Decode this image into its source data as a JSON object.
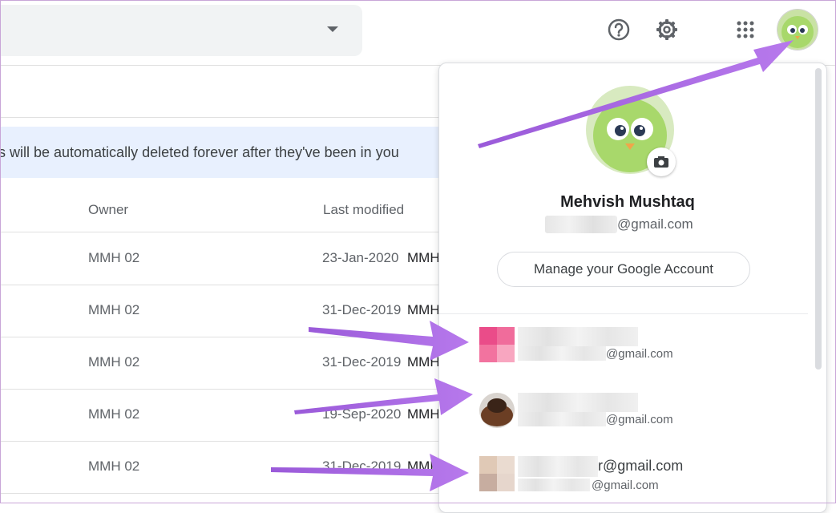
{
  "banner": {
    "text": "s will be automatically deleted forever after they've been in you"
  },
  "table": {
    "headers": {
      "owner": "Owner",
      "last_modified": "Last modified"
    },
    "rows": [
      {
        "owner": "MMH 02",
        "date": "23-Jan-2020",
        "user": "MMH"
      },
      {
        "owner": "MMH 02",
        "date": "31-Dec-2019",
        "user": "MMH"
      },
      {
        "owner": "MMH 02",
        "date": "31-Dec-2019",
        "user": "MMH"
      },
      {
        "owner": "MMH 02",
        "date": "19-Sep-2020",
        "user": "MMH"
      },
      {
        "owner": "MMH 02",
        "date": "31-Dec-2019",
        "user": "MMH"
      }
    ]
  },
  "account_panel": {
    "name": "Mehvish Mushtaq",
    "email_suffix": "@gmail.com",
    "manage_label": "Manage your Google Account",
    "accounts": [
      {
        "email": "@gmail.com"
      },
      {
        "email": "@gmail.com"
      },
      {
        "email_primary": "r@gmail.com",
        "email": "@gmail.com"
      }
    ]
  },
  "icons": {
    "help": "help-circle-icon",
    "settings": "gear-icon",
    "apps": "apps-grid-icon",
    "camera": "camera-icon",
    "dropdown": "caret-down-icon"
  },
  "colors": {
    "banner_bg": "#e8f0fe",
    "arrow": "#a868e0",
    "avatar_green": "#a8d86b"
  }
}
